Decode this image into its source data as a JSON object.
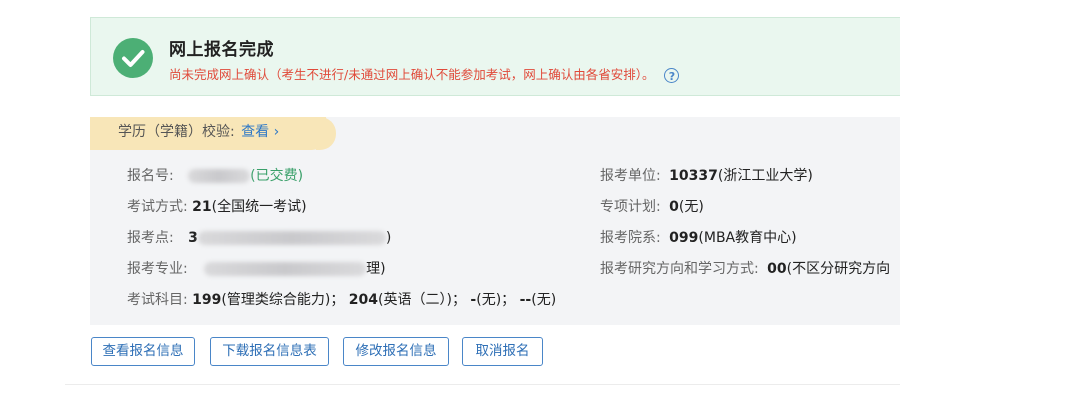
{
  "banner": {
    "title": "网上报名完成",
    "warning": "尚未完成网上确认（考生不进行/未通过网上确认不能参加考试，网上确认由各省安排）。",
    "help_symbol": "?",
    "icon": "check-circle-icon",
    "color": "#4caf75"
  },
  "verify": {
    "label": "学历（学籍）校验:",
    "link": "查看 ›"
  },
  "fields": {
    "reg_no": {
      "label": "报名号:",
      "status": "(已交费)"
    },
    "exam_mode": {
      "label": "考试方式:",
      "code": "21",
      "text": "(全国统一考试)"
    },
    "exam_site": {
      "label": "报考点:",
      "code": "3",
      "tail": ")"
    },
    "major": {
      "label": "报考专业:",
      "tail": "理)"
    },
    "subjects": {
      "label": "考试科目:",
      "items": [
        {
          "code": "199",
          "text": "(管理类综合能力)；"
        },
        {
          "code": "204",
          "text": "(英语（二）)；"
        },
        {
          "code": "-",
          "text": "(无)；"
        },
        {
          "code": "--",
          "text": "(无)"
        }
      ]
    },
    "unit": {
      "label": "报考单位:",
      "code": "10337",
      "text": "(浙江工业大学)"
    },
    "special_plan": {
      "label": "专项计划:",
      "code": "0",
      "text": "(无)"
    },
    "department": {
      "label": "报考院系:",
      "code": "099",
      "text": "(MBA教育中心)"
    },
    "research": {
      "label": "报考研究方向和学习方式:",
      "code": "00",
      "text": "(不区分研究方向"
    }
  },
  "buttons": {
    "view": "查看报名信息",
    "download": "下载报名信息表",
    "modify": "修改报名信息",
    "cancel": "取消报名"
  }
}
